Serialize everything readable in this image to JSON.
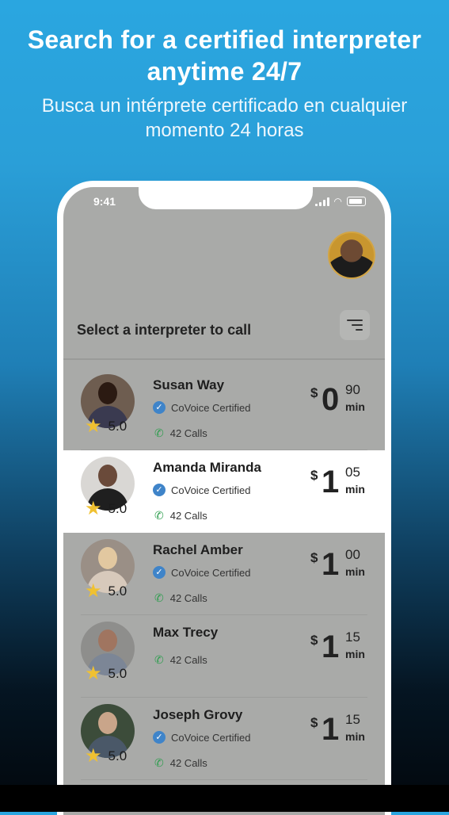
{
  "heading": {
    "en": "Search for a certified interpreter anytime 24/7",
    "es": "Busca un intérprete certificado en cualquier momento 24 horas"
  },
  "status": {
    "time": "9:41"
  },
  "screen": {
    "title": "Select a interpreter to call"
  },
  "interpreters": [
    {
      "name": "Susan Way",
      "rating": "5.0",
      "certified": "CoVoice Certified",
      "calls": "42 Calls",
      "currency": "$",
      "price_int": "0",
      "price_cents": "90",
      "unit": "min",
      "selected": false
    },
    {
      "name": "Amanda Miranda",
      "rating": "5.0",
      "certified": "CoVoice Certified",
      "calls": "42 Calls",
      "currency": "$",
      "price_int": "1",
      "price_cents": "05",
      "unit": "min",
      "selected": true
    },
    {
      "name": "Rachel Amber",
      "rating": "5.0",
      "certified": "CoVoice Certified",
      "calls": "42 Calls",
      "currency": "$",
      "price_int": "1",
      "price_cents": "00",
      "unit": "min",
      "selected": false
    },
    {
      "name": "Max Trecy",
      "rating": "5.0",
      "certified": "",
      "calls": "42 Calls",
      "currency": "$",
      "price_int": "1",
      "price_cents": "15",
      "unit": "min",
      "selected": false
    },
    {
      "name": "Joseph Grovy",
      "rating": "5.0",
      "certified": "CoVoice Certified",
      "calls": "42 Calls",
      "currency": "$",
      "price_int": "1",
      "price_cents": "15",
      "unit": "min",
      "selected": false
    }
  ],
  "colors": {
    "accent": "#2aa6e0",
    "star": "#f0c131",
    "badge": "#3f84c9",
    "call": "#2f9e4f"
  }
}
